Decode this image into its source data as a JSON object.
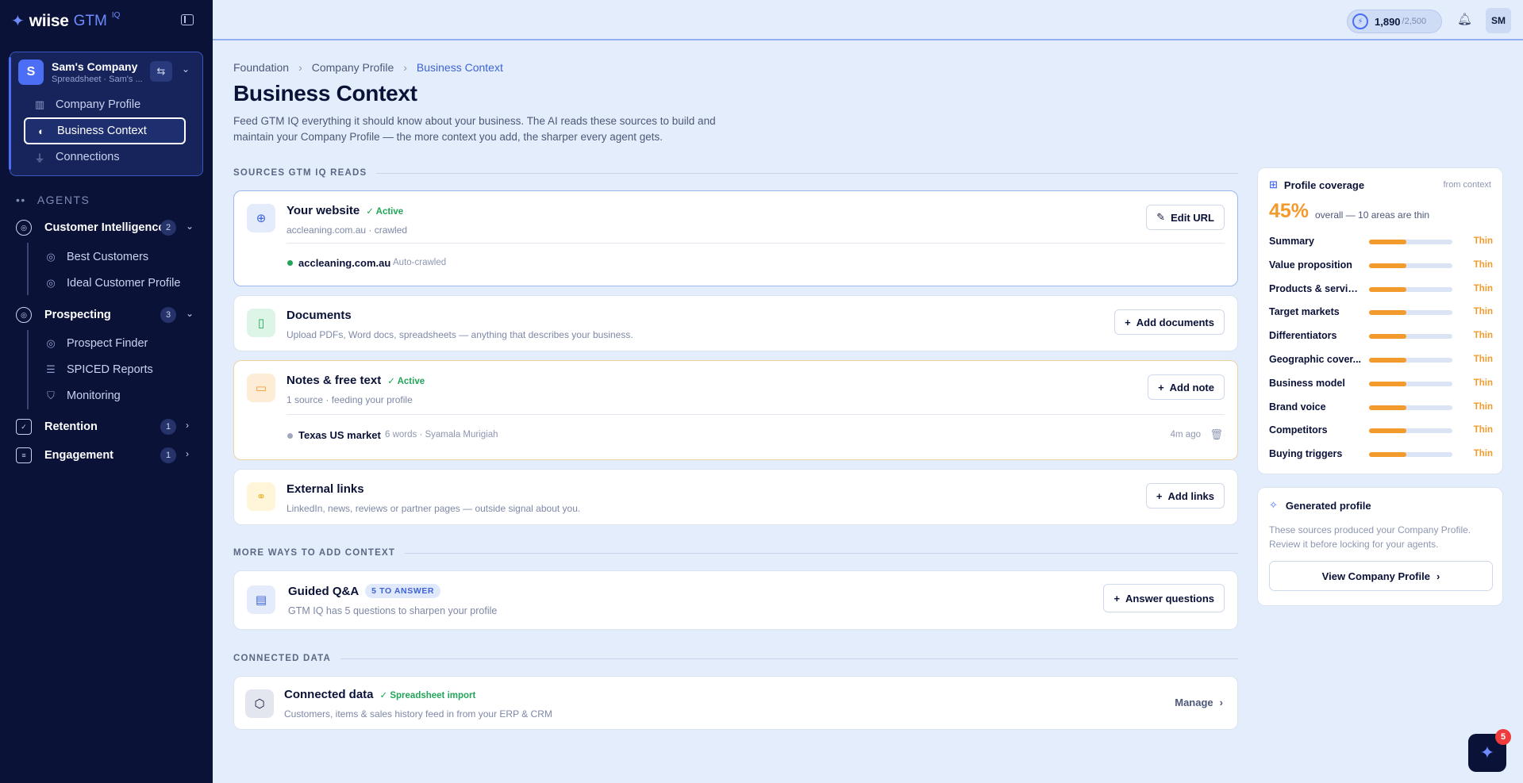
{
  "brand": {
    "name": "wiise",
    "product": "GTM",
    "suffix": "IQ"
  },
  "company": {
    "initial": "S",
    "name": "Sam's Company",
    "subtitle": "Spreadsheet · Sam's ..."
  },
  "company_nav": [
    {
      "label": "Company Profile",
      "icon": "building-icon"
    },
    {
      "label": "Business Context",
      "icon": "book-icon",
      "active": true
    },
    {
      "label": "Connections",
      "icon": "plug-icon"
    }
  ],
  "agents_label": "AGENTS",
  "agent_groups": [
    {
      "label": "Customer Intelligence",
      "count": "2",
      "items": [
        "Best Customers",
        "Ideal Customer Profile"
      ]
    },
    {
      "label": "Prospecting",
      "count": "3",
      "items": [
        "Prospect Finder",
        "SPICED Reports",
        "Monitoring"
      ]
    },
    {
      "label": "Retention",
      "count": "1",
      "items": []
    },
    {
      "label": "Engagement",
      "count": "1",
      "items": []
    }
  ],
  "topbar": {
    "credits": "1,890",
    "credits_max": "/2,500",
    "user_initials": "SM"
  },
  "breadcrumb": [
    "Foundation",
    "Company Profile",
    "Business Context"
  ],
  "page": {
    "title": "Business Context",
    "description": "Feed GTM IQ everything it should know about your business. The AI reads these sources to build and maintain your Company Profile — the more context you add, the sharper every agent gets."
  },
  "sources_label": "SOURCES GTM IQ READS",
  "website": {
    "title": "Your website",
    "status": "Active",
    "subtitle": "accleaning.com.au · crawled",
    "button": "Edit URL",
    "row_main": "accleaning.com.au",
    "row_meta": "Auto-crawled"
  },
  "documents": {
    "title": "Documents",
    "subtitle": "Upload PDFs, Word docs, spreadsheets — anything that describes your business.",
    "button": "Add documents"
  },
  "notes": {
    "title": "Notes & free text",
    "status": "Active",
    "subtitle": "1 source · feeding your profile",
    "button": "Add note",
    "row_main": "Texas US market",
    "row_meta": "6 words · Syamala Murigiah",
    "row_time": "4m ago"
  },
  "links": {
    "title": "External links",
    "subtitle": "LinkedIn, news, reviews or partner pages — outside signal about you.",
    "button": "Add links"
  },
  "more_label": "MORE WAYS TO ADD CONTEXT",
  "qa": {
    "title": "Guided Q&A",
    "badge": "5 TO ANSWER",
    "subtitle": "GTM IQ has 5 questions to sharpen your profile",
    "button": "Answer questions"
  },
  "connected_label": "CONNECTED DATA",
  "connected": {
    "title": "Connected data",
    "status": "Spreadsheet import",
    "subtitle": "Customers, items & sales history feed in from your ERP & CRM",
    "button": "Manage"
  },
  "coverage": {
    "title": "Profile coverage",
    "from": "from context",
    "percent": "45%",
    "overall": "overall — 10 areas are thin",
    "accent": "#f39a2c",
    "rows": [
      {
        "label": "Summary",
        "status": "Thin",
        "level": 0.45
      },
      {
        "label": "Value proposition",
        "status": "Thin",
        "level": 0.45
      },
      {
        "label": "Products & servic...",
        "status": "Thin",
        "level": 0.45
      },
      {
        "label": "Target markets",
        "status": "Thin",
        "level": 0.45
      },
      {
        "label": "Differentiators",
        "status": "Thin",
        "level": 0.45
      },
      {
        "label": "Geographic cover...",
        "status": "Thin",
        "level": 0.45
      },
      {
        "label": "Business model",
        "status": "Thin",
        "level": 0.45
      },
      {
        "label": "Brand voice",
        "status": "Thin",
        "level": 0.45
      },
      {
        "label": "Competitors",
        "status": "Thin",
        "level": 0.45
      },
      {
        "label": "Buying triggers",
        "status": "Thin",
        "level": 0.45
      }
    ]
  },
  "generated": {
    "title": "Generated profile",
    "description": "These sources produced your Company Profile. Review it before locking for your agents.",
    "button": "View Company Profile"
  },
  "fab": {
    "badge": "5"
  }
}
